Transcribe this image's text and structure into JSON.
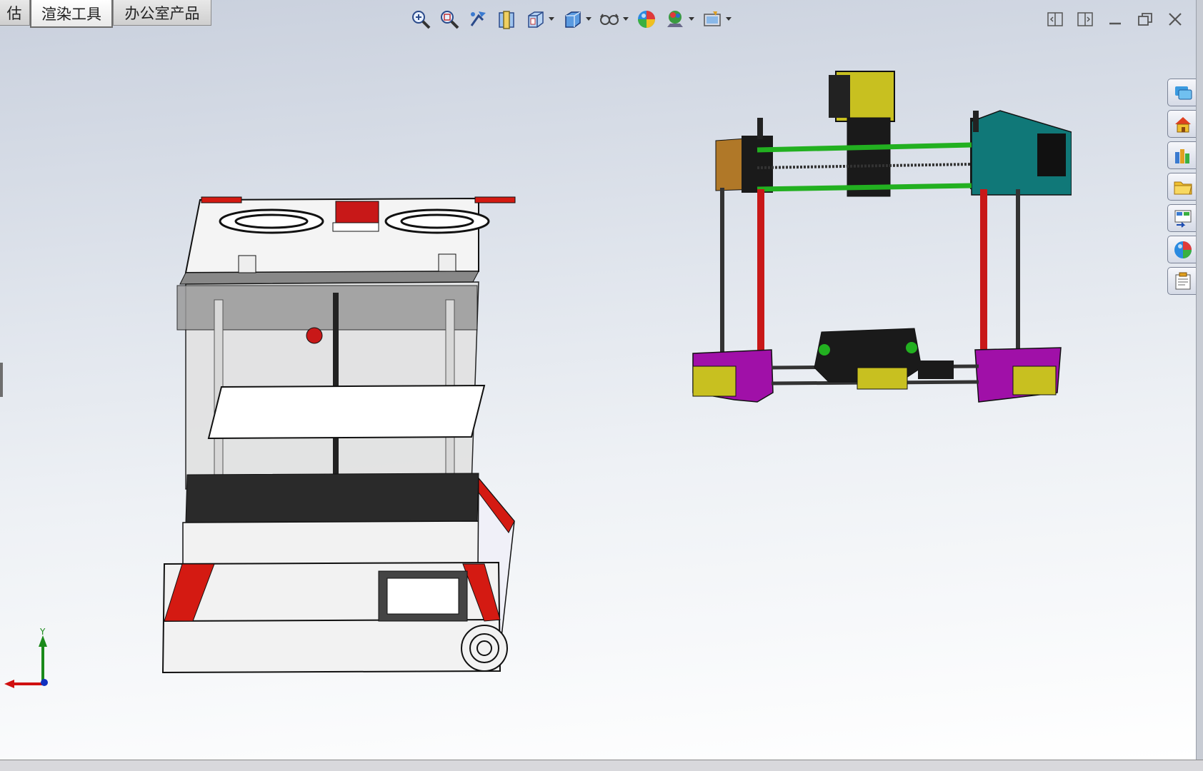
{
  "tabs": [
    {
      "label": "估",
      "active": false
    },
    {
      "label": "渲染工具",
      "active": true
    },
    {
      "label": "办公室产品",
      "active": false
    }
  ],
  "toolbar": {
    "icons": [
      "zoom-to-fit-icon",
      "zoom-to-area-icon",
      "previous-view-icon",
      "section-view-icon",
      "view-orientation-icon",
      "display-style-icon",
      "hide-show-items-icon",
      "edit-appearance-icon",
      "apply-scene-icon",
      "view-settings-icon"
    ]
  },
  "window_controls": [
    "tile-left-icon",
    "tile-right-icon",
    "minimize-icon",
    "restore-icon",
    "close-icon"
  ],
  "task_pane": [
    "solidworks-resources-icon",
    "home-icon",
    "design-library-icon",
    "file-explorer-icon",
    "view-palette-icon",
    "appearances-scenes-icon",
    "custom-properties-icon"
  ],
  "triad": {
    "y_label": "Y",
    "colors": {
      "x": "#d01010",
      "y": "#1a8a1a",
      "z": "#1030c0"
    }
  },
  "colors": {
    "accent_red": "#d41a12",
    "frame_green": "#22b020",
    "magenta": "#a010a8",
    "yellow": "#c8c020",
    "teal": "#107878"
  }
}
